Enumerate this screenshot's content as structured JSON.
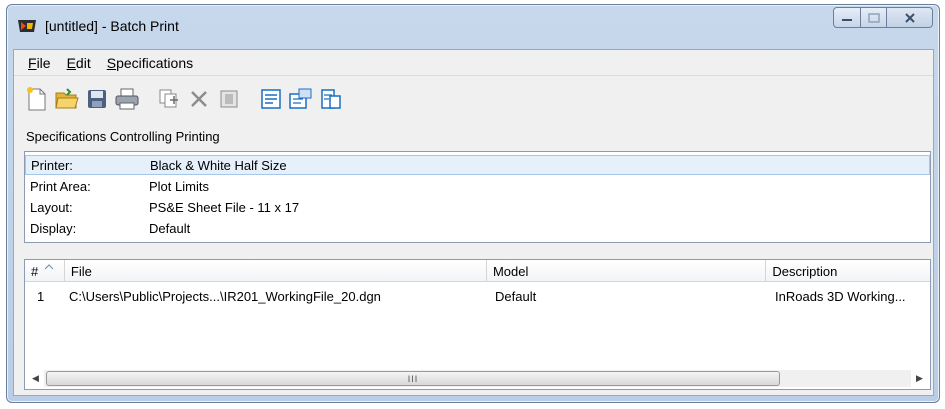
{
  "window": {
    "title": "[untitled] - Batch Print"
  },
  "menu": [
    {
      "label": "File"
    },
    {
      "label": "Edit"
    },
    {
      "label": "Specifications"
    }
  ],
  "toolbar": {
    "icons": [
      "new-file-icon",
      "open-folder-icon",
      "save-icon",
      "print-icon",
      "add-files-icon",
      "delete-icon",
      "properties-icon",
      "preview-icon",
      "print-setup-icon",
      "batch-preview-icon"
    ]
  },
  "specifications": {
    "heading": "Specifications Controlling Printing",
    "rows": [
      {
        "key": "Printer:",
        "value": "Black & White Half Size"
      },
      {
        "key": "Print Area:",
        "value": "Plot Limits"
      },
      {
        "key": "Layout:",
        "value": "PS&E Sheet File - 11 x 17"
      },
      {
        "key": "Display:",
        "value": "Default"
      }
    ]
  },
  "file_list": {
    "columns": [
      "#",
      "File",
      "Model",
      "Description"
    ],
    "rows": [
      {
        "num": "1",
        "file": "C:\\Users\\Public\\Projects...\\IR201_WorkingFile_20.dgn",
        "model": "Default",
        "description": "InRoads 3D Working..."
      }
    ],
    "scroll_grip": "III"
  },
  "colors": {
    "titlebar": "#c7d8ec",
    "selection": "#e6f0fb",
    "toolbar_accent": "#1a6fc4"
  }
}
